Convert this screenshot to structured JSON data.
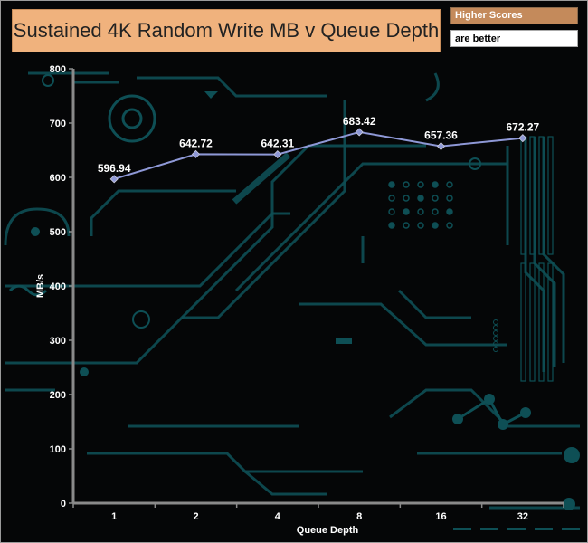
{
  "header": {
    "title": "Sustained 4K Random Write MB v Queue Depth",
    "legend_line1": "Higher Scores",
    "legend_line2": "are better"
  },
  "colors": {
    "title_bg": "#f0b27d",
    "legend_bg": "#c48a5b",
    "series_line": "#8e98d6",
    "background_circuit": "#0e4f55"
  },
  "chart_data": {
    "type": "line",
    "title": "Sustained 4K Random Write MB v Queue Depth",
    "xlabel": "Queue Depth",
    "ylabel": "MB/s",
    "categories": [
      "1",
      "2",
      "4",
      "8",
      "16",
      "32"
    ],
    "series": [
      {
        "values": [
          596.94,
          642.72,
          642.31,
          683.42,
          657.36,
          672.27
        ]
      }
    ],
    "ylim": [
      0,
      800
    ],
    "yticks": [
      0,
      100,
      200,
      300,
      400,
      500,
      600,
      700,
      800
    ],
    "grid": false,
    "data_labels": [
      "596.94",
      "642.72",
      "642.31",
      "683.42",
      "657.36",
      "672.27"
    ]
  }
}
